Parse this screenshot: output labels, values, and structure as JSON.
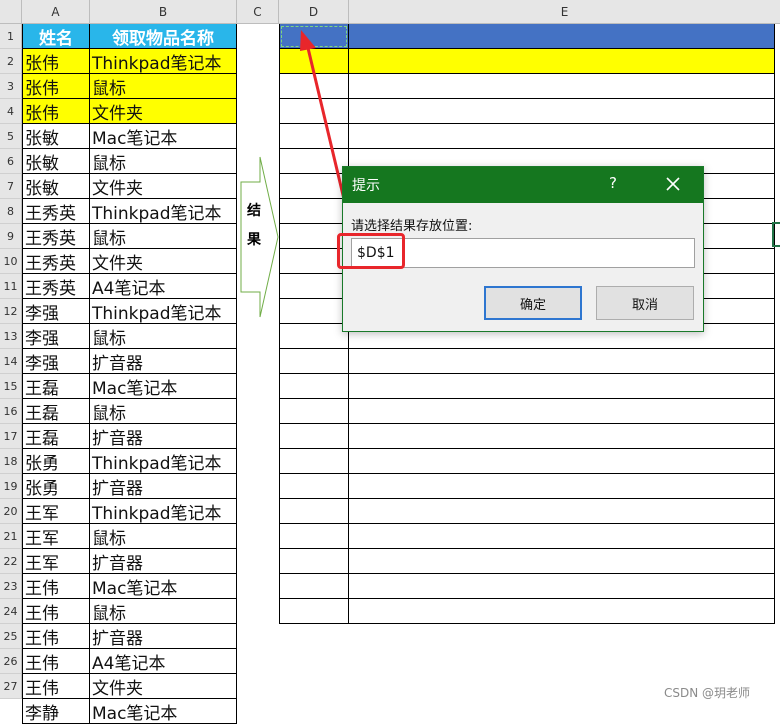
{
  "columns": [
    "A",
    "B",
    "C",
    "D",
    "E"
  ],
  "table": {
    "headers": [
      "姓名",
      "领取物品名称"
    ],
    "rows": [
      [
        "张伟",
        "Thinkpad笔记本"
      ],
      [
        "张伟",
        "鼠标"
      ],
      [
        "张伟",
        "文件夹"
      ],
      [
        "张敏",
        "Mac笔记本"
      ],
      [
        "张敏",
        "鼠标"
      ],
      [
        "张敏",
        "文件夹"
      ],
      [
        "王秀英",
        "Thinkpad笔记本"
      ],
      [
        "王秀英",
        "鼠标"
      ],
      [
        "王秀英",
        "文件夹"
      ],
      [
        "王秀英",
        "A4笔记本"
      ],
      [
        "李强",
        "Thinkpad笔记本"
      ],
      [
        "李强",
        "鼠标"
      ],
      [
        "李强",
        "扩音器"
      ],
      [
        "王磊",
        "Mac笔记本"
      ],
      [
        "王磊",
        "鼠标"
      ],
      [
        "王磊",
        "扩音器"
      ],
      [
        "张勇",
        "Thinkpad笔记本"
      ],
      [
        "张勇",
        "扩音器"
      ],
      [
        "王军",
        "Thinkpad笔记本"
      ],
      [
        "王军",
        "鼠标"
      ],
      [
        "王军",
        "扩音器"
      ],
      [
        "王伟",
        "Mac笔记本"
      ],
      [
        "王伟",
        "鼠标"
      ],
      [
        "王伟",
        "扩音器"
      ],
      [
        "王伟",
        "A4笔记本"
      ],
      [
        "王伟",
        "文件夹"
      ],
      [
        "李静",
        "Mac笔记本"
      ]
    ]
  },
  "row_numbers": [
    "1",
    "2",
    "3",
    "4",
    "5",
    "6",
    "7",
    "8",
    "9",
    "10",
    "11",
    "12",
    "13",
    "14",
    "15",
    "16",
    "17",
    "18",
    "19",
    "20",
    "21",
    "22",
    "23",
    "24",
    "25",
    "26",
    "27"
  ],
  "highlight_color": "#ffff00",
  "header_color": "#29b6ea",
  "result_header_color": "#4472c4",
  "arrow_label": [
    "结",
    "果"
  ],
  "dialog": {
    "title": "提示",
    "help": "?",
    "close_icon": "close-icon",
    "prompt": "请选择结果存放位置:",
    "input_value": "$D$1",
    "ok_label": "确定",
    "cancel_label": "取消",
    "title_color": "#15771f"
  },
  "annotation_color": "#e8262b",
  "watermark": "CSDN @玥老师"
}
